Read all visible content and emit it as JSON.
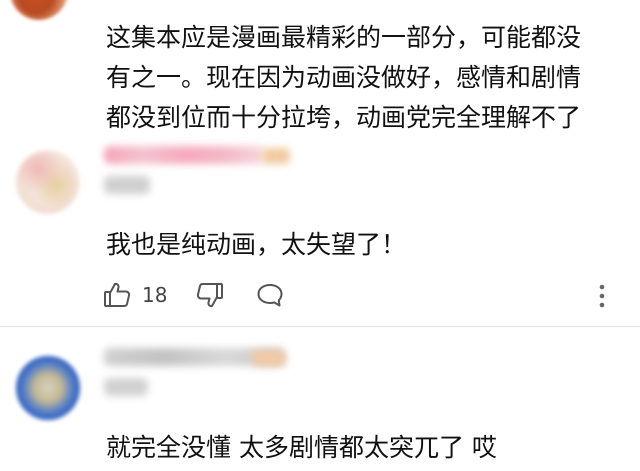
{
  "comments": [
    {
      "text_lines": [
        "这集本应是漫画最精彩的一部分，可能都没",
        "有之一。现在因为动画没做好，感情和剧情",
        "都没到位而十分拉垮，动画党完全理解不了"
      ]
    },
    {
      "text": "我也是纯动画，太失望了！",
      "actions": {
        "like_icon": "thumbs-up-icon",
        "like_count": "18",
        "dislike_icon": "thumbs-down-icon",
        "reply_icon": "comment-bubble-icon",
        "more_icon": "vertical-ellipsis-icon"
      }
    },
    {
      "text": "就完全没懂 太多剧情都太突兀了 哎"
    }
  ],
  "colors": {
    "text": "#111111",
    "icon": "#555555",
    "divider": "#e6e6e6"
  }
}
